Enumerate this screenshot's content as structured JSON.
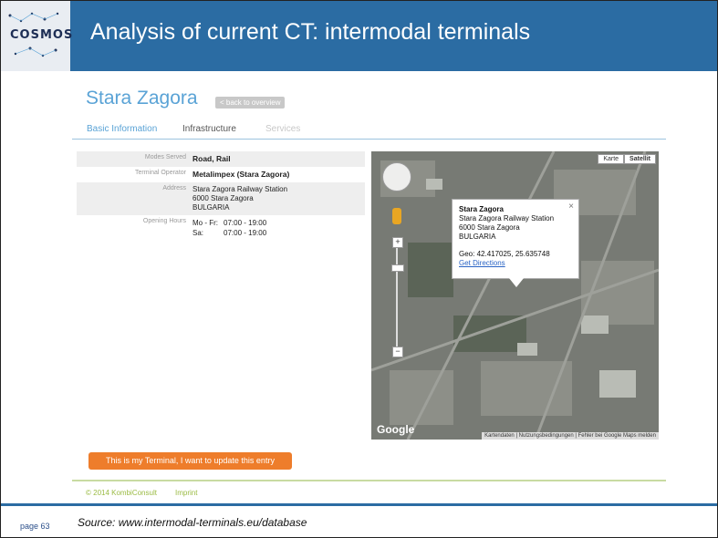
{
  "slide": {
    "logo": "COSMOS",
    "title": "Analysis of current CT: intermodal terminals",
    "page_number": "page 63",
    "source": "Source: www.intermodal-terminals.eu/database",
    "colors": {
      "header": "#2b6ca3",
      "accent_orange": "#ee7d2b",
      "link_blue": "#5aa3d6"
    }
  },
  "site": {
    "title": "Stara Zagora",
    "back_label": "< back to overview",
    "tabs": [
      {
        "label": "Basic Information",
        "active": true
      },
      {
        "label": "Infrastructure",
        "active": false
      },
      {
        "label": "Services",
        "active": false
      }
    ],
    "info": {
      "modes_label": "Modes Served",
      "modes_value": "Road, Rail",
      "operator_label": "Terminal Operator",
      "operator_value": "Metalimpex (Stara Zagora)",
      "address_label": "Address",
      "address_lines": [
        "Stara Zagora Railway Station",
        "6000 Stara Zagora",
        "BULGARIA"
      ],
      "hours_label": "Opening Hours",
      "hours": [
        {
          "days": "Mo - Fr:",
          "time": "07:00 - 19:00"
        },
        {
          "days": "Sa:",
          "time": "07:00 - 19:00"
        }
      ]
    },
    "map": {
      "type_buttons": [
        "Karte",
        "Satellit"
      ],
      "popup": {
        "name": "Stara Zagora",
        "line1": "Stara Zagora Railway Station",
        "line2": "6000 Stara Zagora",
        "line3": "BULGARIA",
        "geo": "Geo: 42.417025, 25.635748",
        "link": "Get Directions"
      },
      "google": "Google",
      "attribution": "Kartendaten | Nutzungsbedingungen | Fehler bei Google Maps melden"
    },
    "update_button": "This is my Terminal, I want to update this entry",
    "footer": {
      "copyright": "© 2014 KombiConsult",
      "imprint": "Imprint"
    }
  }
}
